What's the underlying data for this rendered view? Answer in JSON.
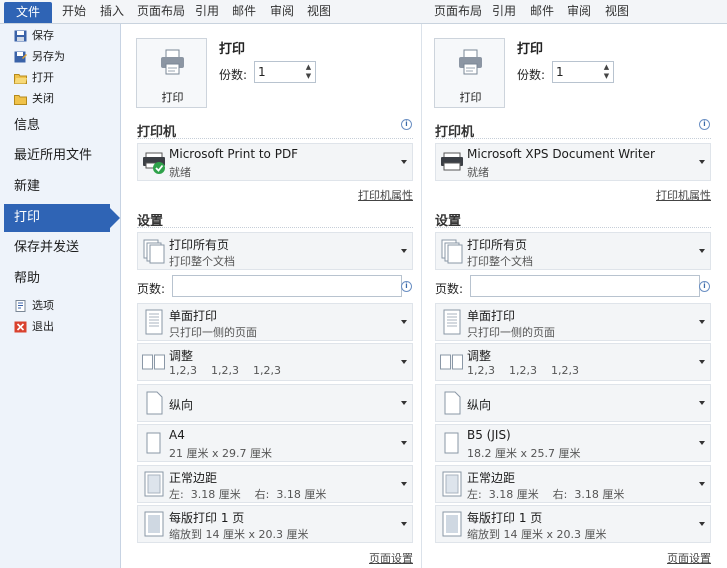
{
  "ribbon": {
    "file": "文件",
    "tabs_left": [
      "开始",
      "插入",
      "页面布局",
      "引用",
      "邮件",
      "审阅",
      "视图"
    ],
    "tabs_right": [
      "页面布局",
      "引用",
      "邮件",
      "审阅",
      "视图"
    ]
  },
  "backstage": {
    "commands": [
      {
        "label": "保存",
        "icon": "save-icon"
      },
      {
        "label": "另存为",
        "icon": "save-as-icon"
      },
      {
        "label": "打开",
        "icon": "open-folder-icon"
      },
      {
        "label": "关闭",
        "icon": "close-folder-icon"
      }
    ],
    "sections": [
      "信息",
      "最近所用文件",
      "新建",
      "打印",
      "保存并发送",
      "帮助"
    ],
    "active_section": "打印",
    "bottom_commands": [
      {
        "label": "选项",
        "icon": "options-icon"
      },
      {
        "label": "退出",
        "icon": "exit-icon"
      }
    ]
  },
  "panes": [
    {
      "print_button": "打印",
      "print_title": "打印",
      "copies_label": "份数:",
      "copies_value": "1",
      "printer_heading": "打印机",
      "printer_name": "Microsoft Print to PDF",
      "printer_status": "就绪",
      "printer_props": "打印机属性",
      "settings_heading": "设置",
      "print_range": {
        "title": "打印所有页",
        "sub": "打印整个文档"
      },
      "pages_label": "页数:",
      "sides": {
        "title": "单面打印",
        "sub": "只打印一侧的页面"
      },
      "collate": {
        "title": "调整",
        "sub": "1,2,3    1,2,3    1,2,3"
      },
      "orientation": {
        "title": "纵向",
        "sub": ""
      },
      "paper": {
        "title": "A4",
        "sub": "21 厘米 x 29.7 厘米"
      },
      "margins": {
        "title": "正常边距",
        "sub": "左:  3.18 厘米    右:  3.18 厘米"
      },
      "per_sheet": {
        "title": "每版打印 1 页",
        "sub": "缩放到 14 厘米 x 20.3 厘米"
      },
      "page_setup": "页面设置"
    },
    {
      "print_button": "打印",
      "print_title": "打印",
      "copies_label": "份数:",
      "copies_value": "1",
      "printer_heading": "打印机",
      "printer_name": "Microsoft XPS Document Writer",
      "printer_status": "就绪",
      "printer_props": "打印机属性",
      "settings_heading": "设置",
      "print_range": {
        "title": "打印所有页",
        "sub": "打印整个文档"
      },
      "pages_label": "页数:",
      "sides": {
        "title": "单面打印",
        "sub": "只打印一侧的页面"
      },
      "collate": {
        "title": "调整",
        "sub": "1,2,3    1,2,3    1,2,3"
      },
      "orientation": {
        "title": "纵向",
        "sub": ""
      },
      "paper": {
        "title": "B5 (JIS)",
        "sub": "18.2 厘米 x 25.7 厘米"
      },
      "margins": {
        "title": "正常边距",
        "sub": "左:  3.18 厘米    右:  3.18 厘米"
      },
      "per_sheet": {
        "title": "每版打印 1 页",
        "sub": "缩放到 14 厘米 x 20.3 厘米"
      },
      "page_setup": "页面设置"
    }
  ],
  "colors": {
    "accent": "#2f64b5",
    "sidebar_bg": "#eef3fa"
  }
}
